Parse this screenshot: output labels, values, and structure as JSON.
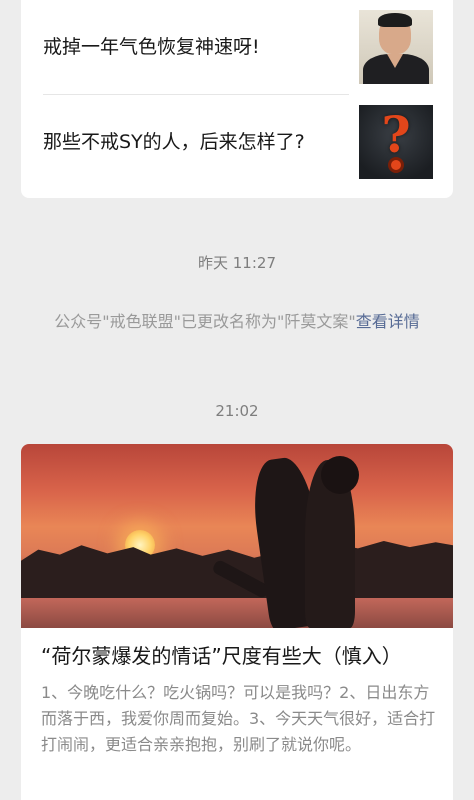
{
  "articles_top": [
    {
      "title": "戒掉一年气色恢复神速呀!",
      "thumb_icon": "person-portrait-thumbnail"
    },
    {
      "title": "那些不戒SY的人，后来怎样了?",
      "thumb_icon": "question-mark-thumbnail"
    }
  ],
  "timestamps": [
    "昨天 11:27",
    "21:02"
  ],
  "notice": {
    "text": "公众号\"戒色联盟\"已更改名称为\"阡莫文案\"",
    "link": "查看详情"
  },
  "article_bottom": {
    "title": "“荷尔蒙爆发的情话”尺度有些大（慎入）",
    "digest": "1、今晚吃什么？吃火锅吗？可以是我吗？2、日出东方而落于西，我爱你周而复始。3、今天天气很好，适合打打闹闹，更适合亲亲抱抱，别刷了就说你呢。",
    "cover_icon": "sunset-couple-cover"
  },
  "colors": {
    "background": "#ededed",
    "card": "#ffffff",
    "link": "#576b95",
    "muted_text": "#9a9a9a"
  }
}
